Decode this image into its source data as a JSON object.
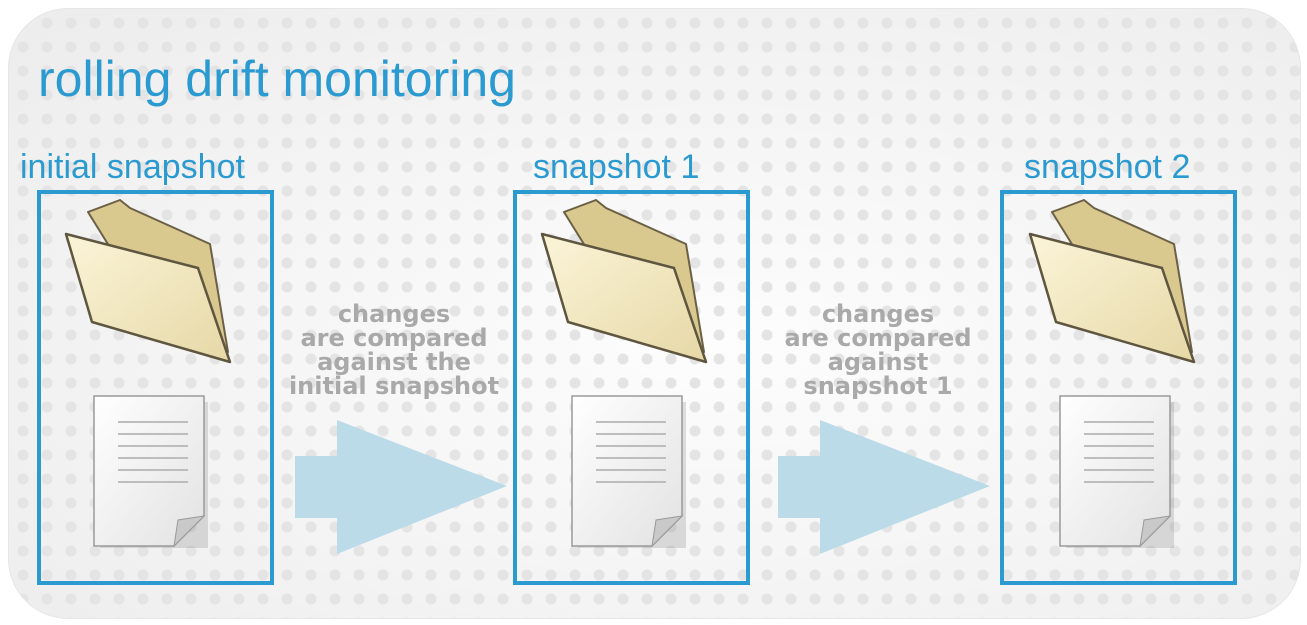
{
  "title": "rolling drift monitoring",
  "snapshots": [
    {
      "label": "initial snapshot"
    },
    {
      "label": "snapshot 1"
    },
    {
      "label": "snapshot 2"
    }
  ],
  "transitions": [
    {
      "caption_lines": [
        "changes",
        "are compared",
        "against the",
        "initial snapshot"
      ]
    },
    {
      "caption_lines": [
        "changes",
        "are compared",
        "against",
        "snapshot 1"
      ]
    }
  ],
  "colors": {
    "accent": "#2a9ad1",
    "arrow": "#bcdbe9",
    "caption": "#a9a9a9",
    "folder": "#f3e7bd"
  },
  "icons": [
    "folder-icon",
    "document-icon",
    "right-arrow-icon"
  ]
}
